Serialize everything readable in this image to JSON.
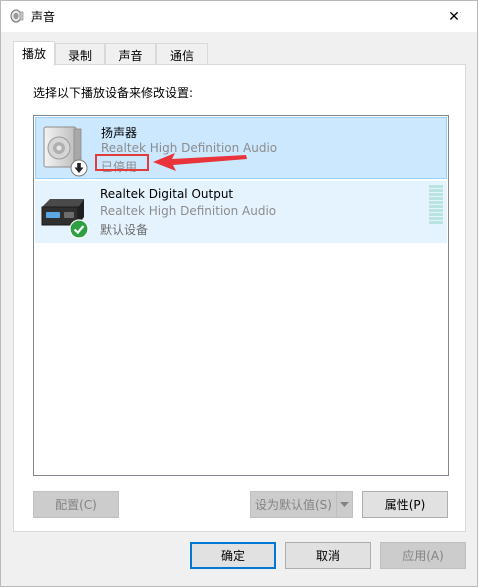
{
  "window": {
    "title": "声音",
    "close_glyph": "✕"
  },
  "tabs": [
    {
      "label": "播放",
      "active": true
    },
    {
      "label": "录制",
      "active": false
    },
    {
      "label": "声音",
      "active": false
    },
    {
      "label": "通信",
      "active": false
    }
  ],
  "panel": {
    "instruction": "选择以下播放设备来修改设置:"
  },
  "devices": [
    {
      "name": "扬声器",
      "driver": "Realtek High Definition Audio",
      "status": "已停用",
      "icon": "speaker-icon",
      "badge": "down-arrow-badge-icon",
      "selected": true
    },
    {
      "name": "Realtek Digital Output",
      "driver": "Realtek High Definition Audio",
      "status": "默认设备",
      "icon": "digital-output-icon",
      "badge": "default-check-badge-icon",
      "selected": false
    }
  ],
  "panel_buttons": {
    "configure": "配置(C)",
    "set_default": "设为默认值(S)",
    "properties": "属性(P)"
  },
  "dialog_buttons": {
    "ok": "确定",
    "cancel": "取消",
    "apply": "应用(A)"
  },
  "colors": {
    "selection_bg": "#cce8ff",
    "selection_border": "#99d1ff",
    "annotation_red": "#e23b3b",
    "default_green": "#2ea043"
  }
}
